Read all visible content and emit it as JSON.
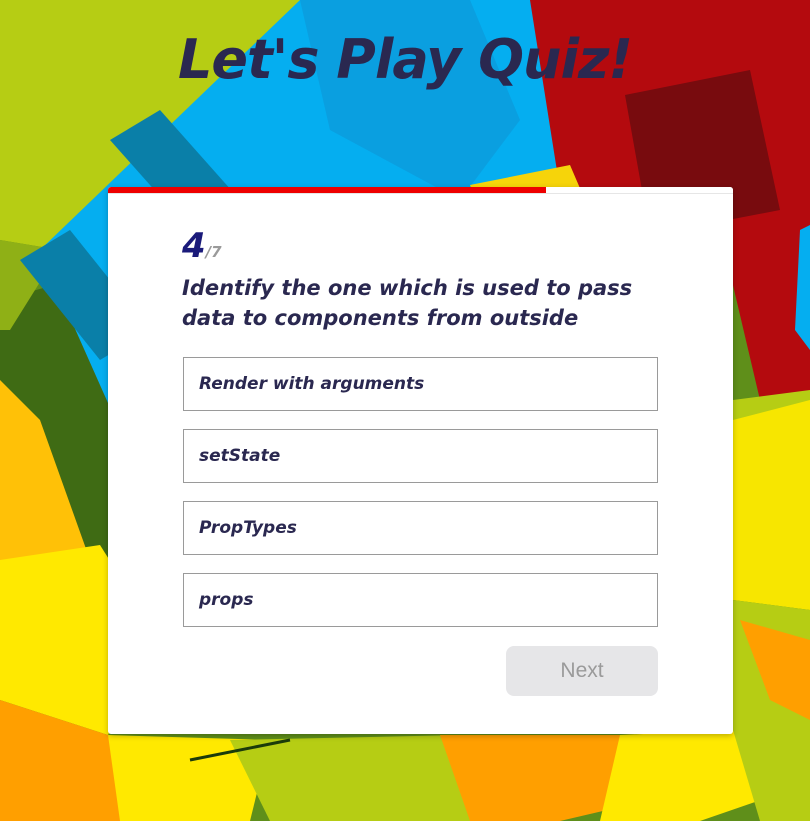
{
  "app": {
    "title": "Let's Play Quiz!"
  },
  "quiz": {
    "progress_fraction": 0.7,
    "current_question": "4",
    "total_questions": "/7",
    "question_text": "Identify the one which is used to pass data to components from outside",
    "options": [
      "Render with arguments",
      "setState",
      "PropTypes",
      "props"
    ],
    "next_label": "Next",
    "next_enabled": false
  },
  "colors": {
    "progress": "#ee0000",
    "title_text": "#2a2850",
    "counter_number": "#1a1a7a",
    "next_bg_disabled": "#e6e6e8"
  }
}
